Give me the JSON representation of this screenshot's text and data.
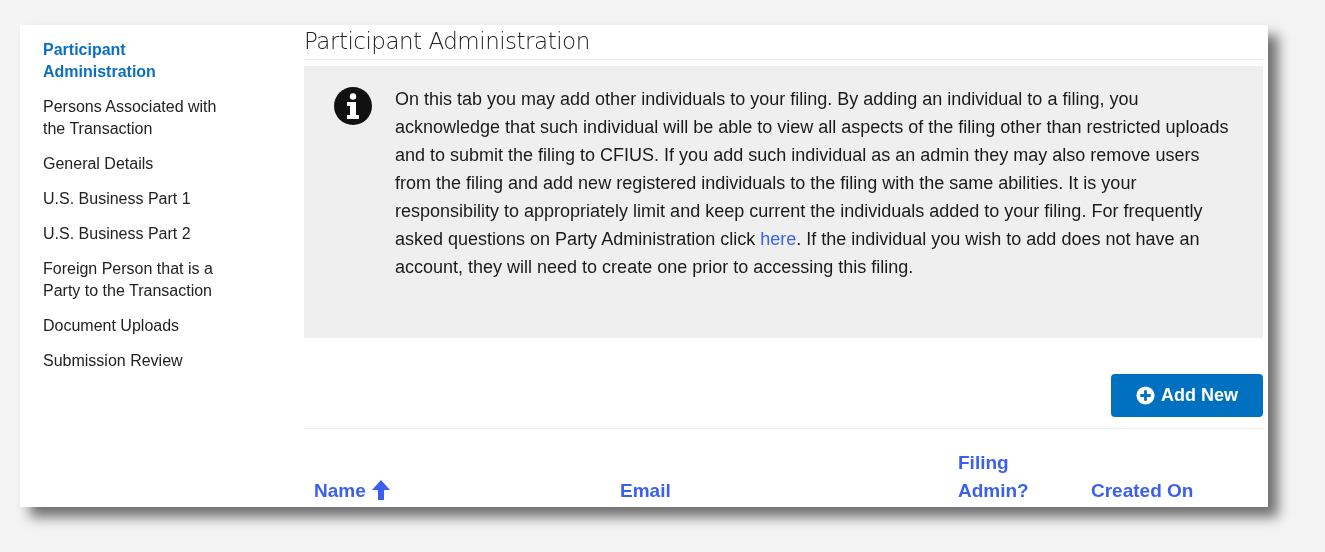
{
  "sidebar": {
    "items": [
      {
        "label": "Participant Administration",
        "selected": true
      },
      {
        "label": "Persons Associated with the Transaction",
        "selected": false
      },
      {
        "label": "General Details",
        "selected": false
      },
      {
        "label": "U.S. Business Part 1",
        "selected": false
      },
      {
        "label": "U.S. Business Part 2",
        "selected": false
      },
      {
        "label": "Foreign Person that is a Party to the Transaction",
        "selected": false
      },
      {
        "label": "Document Uploads",
        "selected": false
      },
      {
        "label": "Submission Review",
        "selected": false
      }
    ]
  },
  "page_title": "Participant Administration",
  "info": {
    "text_before": "On this tab you may add other individuals to your filing. By adding an individual to a filing, you acknowledge that such individual will be able to view all aspects of the filing other than restricted uploads and to submit the filing to CFIUS. If you add such individual as an admin they may also remove users from the filing and add new registered individuals to the filing with the same abilities. It is your responsibility to appropriately limit and keep current the individuals added to your filing. For frequently asked questions on Party Administration click ",
    "link": "here",
    "text_after": ". If the individual you wish to add does not have an account, they will need to create one prior to accessing this filing."
  },
  "add_button": "Add New",
  "table": {
    "columns": [
      {
        "label": "Name",
        "sorted": true
      },
      {
        "label": "Email",
        "sorted": false
      },
      {
        "label": "Filing Admin?",
        "sorted": false
      },
      {
        "label": "Created On",
        "sorted": false
      }
    ]
  }
}
